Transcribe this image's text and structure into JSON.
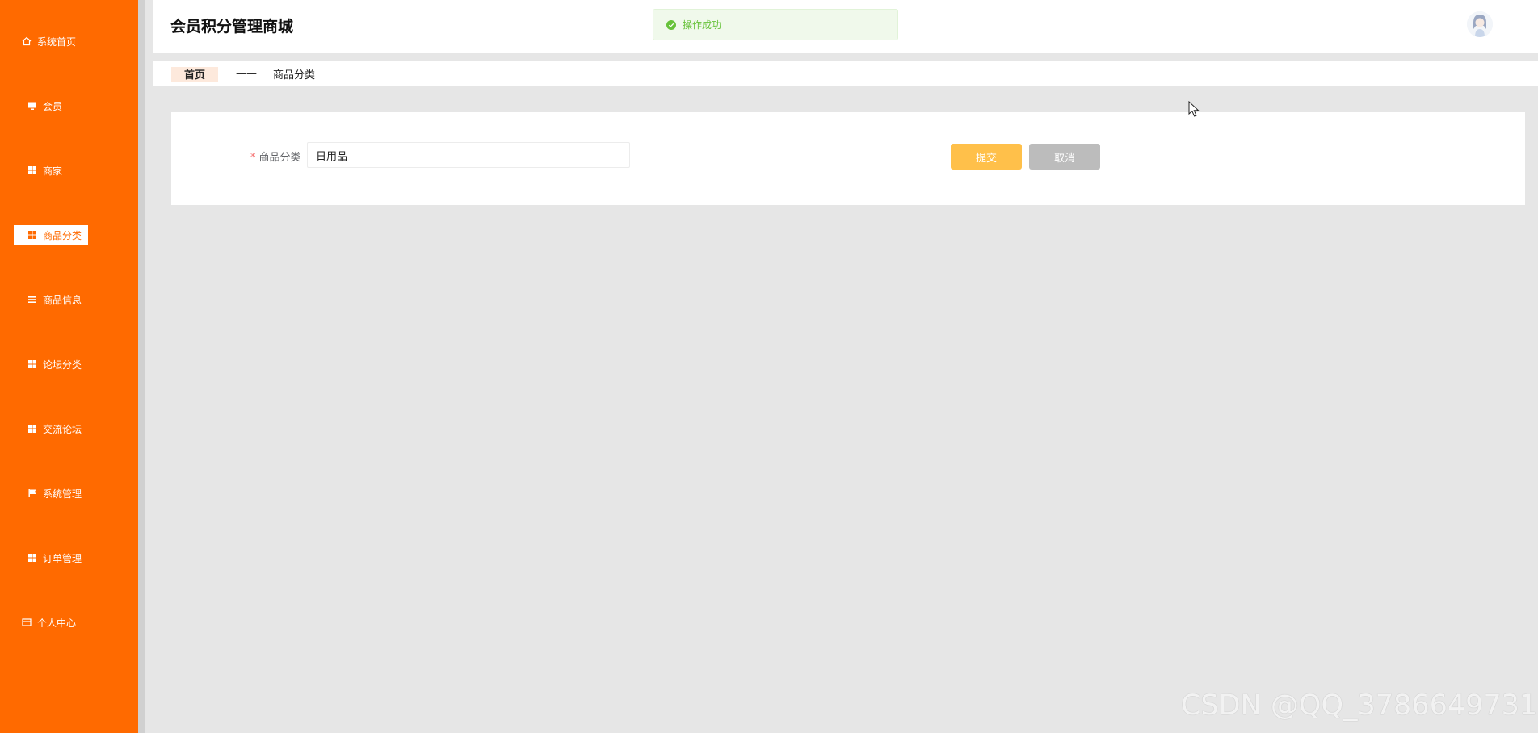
{
  "sidebar": {
    "items": [
      {
        "label": "系统首页",
        "icon": "home-icon"
      },
      {
        "label": "会员",
        "icon": "monitor-icon"
      },
      {
        "label": "商家",
        "icon": "grid-icon"
      },
      {
        "label": "商品分类",
        "icon": "grid-icon",
        "active": true
      },
      {
        "label": "商品信息",
        "icon": "list-icon"
      },
      {
        "label": "论坛分类",
        "icon": "grid-icon"
      },
      {
        "label": "交流论坛",
        "icon": "grid-icon"
      },
      {
        "label": "系统管理",
        "icon": "flag-icon"
      },
      {
        "label": "订单管理",
        "icon": "grid-icon"
      },
      {
        "label": "个人中心",
        "icon": "card-icon"
      }
    ],
    "bg_color": "#ff6a00"
  },
  "header": {
    "title": "会员积分管理商城",
    "toast": "操作成功"
  },
  "breadcrumb": {
    "home": "首页",
    "separator": "——",
    "current": "商品分类"
  },
  "form": {
    "field_label": "商品分类",
    "field_value": "日用品",
    "submit_label": "提交",
    "cancel_label": "取消",
    "submit_color": "#ffc04a",
    "cancel_color": "#bcbcbc"
  },
  "watermark": "CSDN @QQ_3786649731"
}
